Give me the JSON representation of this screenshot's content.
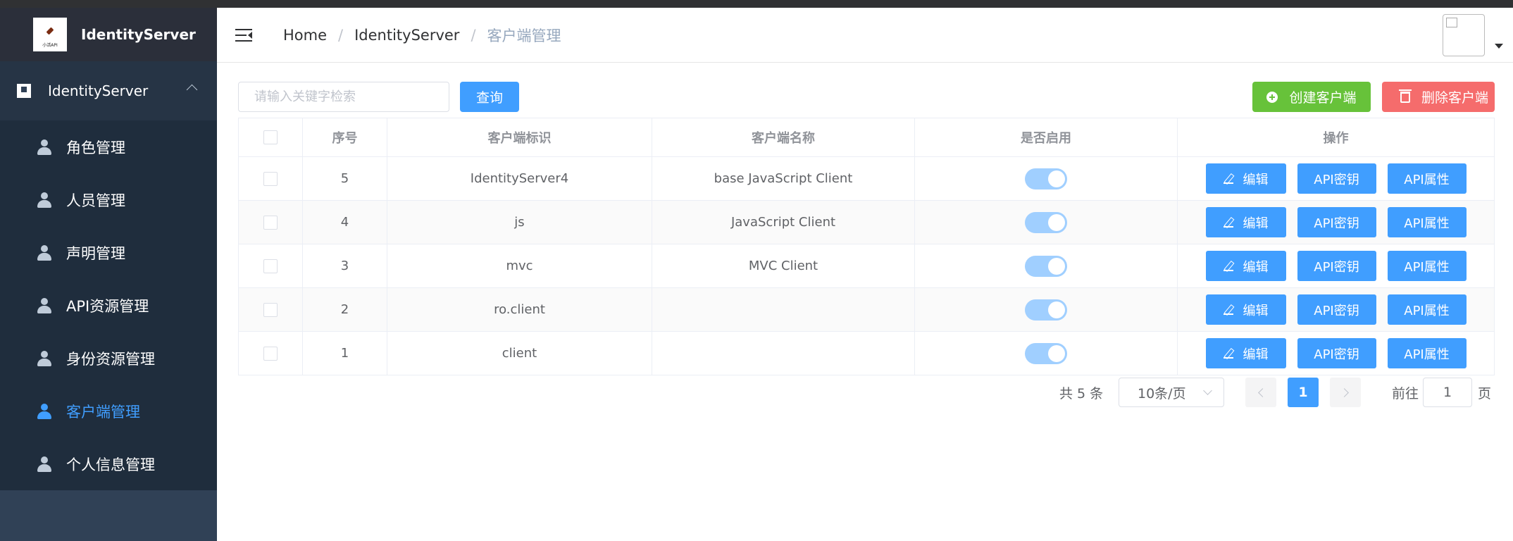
{
  "brand": {
    "title": "IdentityServer",
    "logo_caption": "小活API"
  },
  "sidebar": {
    "group_title": "IdentityServer",
    "items": [
      {
        "label": "角色管理",
        "icon": "user-icon"
      },
      {
        "label": "人员管理",
        "icon": "user-icon"
      },
      {
        "label": "声明管理",
        "icon": "user-icon"
      },
      {
        "label": "API资源管理",
        "icon": "user-icon"
      },
      {
        "label": "身份资源管理",
        "icon": "user-icon"
      },
      {
        "label": "客户端管理",
        "icon": "user-icon",
        "active": true
      },
      {
        "label": "个人信息管理",
        "icon": "user-icon"
      }
    ]
  },
  "header": {
    "breadcrumb": [
      "Home",
      "IdentityServer",
      "客户端管理"
    ]
  },
  "toolbar": {
    "search_placeholder": "请输入关键字检索",
    "search_value": "",
    "query_label": "查询",
    "create_label": "创建客户端",
    "delete_label": "删除客户端"
  },
  "table": {
    "columns": [
      "",
      "序号",
      "客户端标识",
      "客户端名称",
      "是否启用",
      "操作"
    ],
    "rows": [
      {
        "id": "5",
        "client_id": "IdentityServer4",
        "name": "base JavaScript Client",
        "enabled": true
      },
      {
        "id": "4",
        "client_id": "js",
        "name": "JavaScript Client",
        "enabled": true
      },
      {
        "id": "3",
        "client_id": "mvc",
        "name": "MVC Client",
        "enabled": true
      },
      {
        "id": "2",
        "client_id": "ro.client",
        "name": "",
        "enabled": true
      },
      {
        "id": "1",
        "client_id": "client",
        "name": "",
        "enabled": true
      }
    ],
    "actions": {
      "edit": "编辑",
      "secret": "API密钥",
      "property": "API属性"
    }
  },
  "pagination": {
    "total_text": "共 5 条",
    "page_size": "10条/页",
    "current_page": "1",
    "goto_label": "前往",
    "goto_value": "1",
    "goto_suffix": "页"
  },
  "colors": {
    "primary": "#409eff",
    "success": "#67c23a",
    "danger": "#f56c6c",
    "sidebar_bg": "#304156"
  }
}
